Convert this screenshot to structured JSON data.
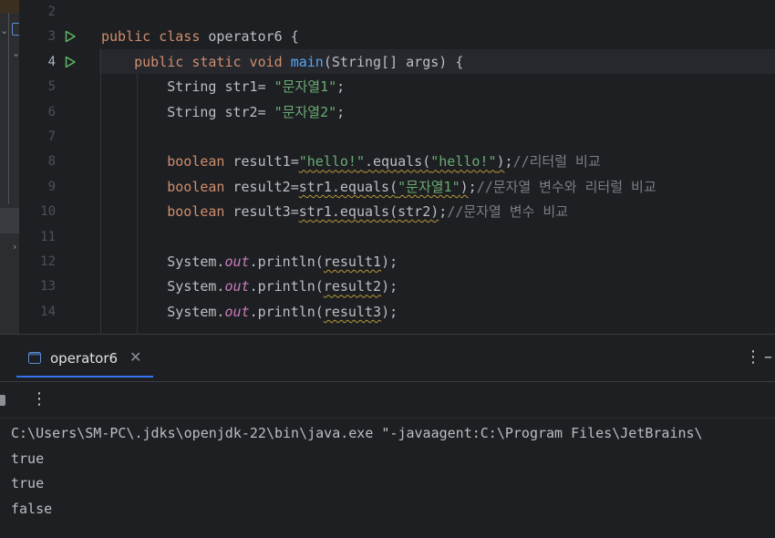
{
  "editor": {
    "line_numbers": [
      "2",
      "3",
      "4",
      "5",
      "6",
      "7",
      "8",
      "9",
      "10",
      "11",
      "12",
      "13",
      "14"
    ],
    "current_line": "4",
    "lines": [
      [],
      [
        {
          "t": "public class ",
          "c": "kw"
        },
        {
          "t": "operator6 {",
          "c": "plain"
        }
      ],
      [
        {
          "t": "    public static void ",
          "c": "kw"
        },
        {
          "t": "main",
          "c": "fn"
        },
        {
          "t": "(String[] args) {",
          "c": "plain"
        }
      ],
      [
        {
          "t": "        String str1= ",
          "c": "plain"
        },
        {
          "t": "\"문자열1\"",
          "c": "str"
        },
        {
          "t": ";",
          "c": "plain"
        }
      ],
      [
        {
          "t": "        String str2= ",
          "c": "plain"
        },
        {
          "t": "\"문자열2\"",
          "c": "str"
        },
        {
          "t": ";",
          "c": "plain"
        }
      ],
      [],
      [
        {
          "t": "        boolean ",
          "c": "kw"
        },
        {
          "t": "result1=",
          "c": "plain"
        },
        {
          "t": "\"hello!\"",
          "c": "str squig"
        },
        {
          "t": ".equals(",
          "c": "plain squig"
        },
        {
          "t": "\"hello!\"",
          "c": "str squig"
        },
        {
          "t": ")",
          "c": "plain squig"
        },
        {
          "t": ";",
          "c": "plain"
        },
        {
          "t": "//리터럴 비교",
          "c": "cmt"
        }
      ],
      [
        {
          "t": "        boolean ",
          "c": "kw"
        },
        {
          "t": "result2=",
          "c": "plain"
        },
        {
          "t": "str1.equals(",
          "c": "plain squig"
        },
        {
          "t": "\"문자열1\"",
          "c": "str squig"
        },
        {
          "t": ")",
          "c": "plain squig"
        },
        {
          "t": ";",
          "c": "plain"
        },
        {
          "t": "//문자열 변수와 리터럴 비교",
          "c": "cmt"
        }
      ],
      [
        {
          "t": "        boolean ",
          "c": "kw"
        },
        {
          "t": "result3=",
          "c": "plain"
        },
        {
          "t": "str1.equals(str2)",
          "c": "plain squig"
        },
        {
          "t": ";",
          "c": "plain"
        },
        {
          "t": "//문자열 변수 비교",
          "c": "cmt"
        }
      ],
      [],
      [
        {
          "t": "        System.",
          "c": "plain"
        },
        {
          "t": "out",
          "c": "st"
        },
        {
          "t": ".println(",
          "c": "plain"
        },
        {
          "t": "result1",
          "c": "plain squig"
        },
        {
          "t": ");",
          "c": "plain"
        }
      ],
      [
        {
          "t": "        System.",
          "c": "plain"
        },
        {
          "t": "out",
          "c": "st"
        },
        {
          "t": ".println(",
          "c": "plain"
        },
        {
          "t": "result2",
          "c": "plain squig"
        },
        {
          "t": ");",
          "c": "plain"
        }
      ],
      [
        {
          "t": "        System.",
          "c": "plain"
        },
        {
          "t": "out",
          "c": "st"
        },
        {
          "t": ".println(",
          "c": "plain"
        },
        {
          "t": "result3",
          "c": "plain squig"
        },
        {
          "t": ");",
          "c": "plain"
        }
      ]
    ]
  },
  "run_panel": {
    "tab_label": "operator6",
    "tab_close": "✕",
    "menu_glyph": "⋮",
    "toolbar_more_glyph": "⋮",
    "console_lines": [
      "C:\\Users\\SM-PC\\.jdks\\openjdk-22\\bin\\java.exe \"-javaagent:C:\\Program Files\\JetBrains\\",
      "true",
      "true",
      "false"
    ]
  },
  "colors": {
    "accent": "#3574f0",
    "run_icon": "#5fb865",
    "keyword": "#cf8e6d",
    "string": "#6aab73",
    "comment": "#7a7e85"
  }
}
